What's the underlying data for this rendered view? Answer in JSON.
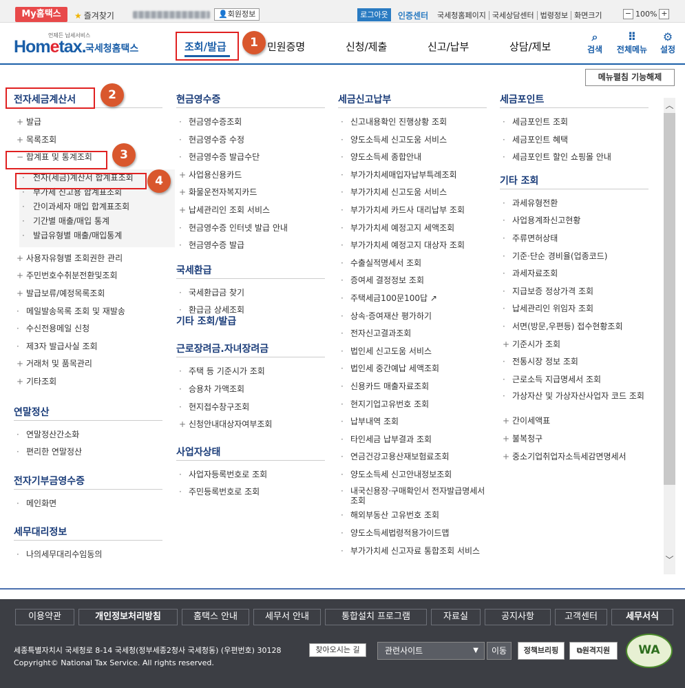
{
  "topbar": {
    "my_hometax": "My홈택스",
    "favorites": "즐겨찾기",
    "member_info": "회원정보",
    "logout": "로그아웃",
    "cert_center": "인증센터",
    "links": [
      "국세청홈페이지",
      "국세상담센터",
      "법령정보",
      "화면크기"
    ],
    "zoom_minus": "−",
    "zoom_value": "100%",
    "zoom_plus": "+"
  },
  "header": {
    "logo_sub": "언제든 납세서비스",
    "logo_main_a": "Hom",
    "logo_main_e": "e",
    "logo_main_b": "tax.",
    "logo_kr": "국세청홈택스",
    "gnb": [
      "조회/발급",
      "민원증명",
      "신청/제출",
      "신고/납부",
      "상담/제보"
    ],
    "tools": [
      {
        "icon": "search-icon",
        "glyph": "🔍",
        "label": "검색"
      },
      {
        "icon": "grid-icon",
        "glyph": "⠿",
        "label": "전체메뉴"
      },
      {
        "icon": "gear-icon",
        "glyph": "⚙",
        "label": "설정"
      }
    ]
  },
  "markers": [
    "1",
    "2",
    "3",
    "4"
  ],
  "menu_toggle": "메뉴펼침 기능해제",
  "col1": {
    "title": "전자세금계산서",
    "items_top": [
      {
        "icon": "plus",
        "label": "발급"
      },
      {
        "icon": "plus",
        "label": "목록조회"
      },
      {
        "icon": "minus",
        "label": "합계표 및 통계조회"
      }
    ],
    "sub_items": [
      "전자(세금)계산서 합계표조회",
      "부가세 신고용 합계표조회",
      "간이과세자 매입 합계표조회",
      "기간별 매출/매입 통계",
      "발급유형별 매출/매입통계"
    ],
    "items_bottom": [
      {
        "icon": "plus",
        "label": "사용자유형별 조회권한 관리"
      },
      {
        "icon": "plus",
        "label": "주민번호수취분전환및조회"
      },
      {
        "icon": "plus",
        "label": "발급보류/예정목록조회"
      },
      {
        "icon": "dot",
        "label": "메일발송목록 조회 및 재발송"
      },
      {
        "icon": "dot",
        "label": "수신전용메일 신청"
      },
      {
        "icon": "dot",
        "label": "제3자 발급사실 조회"
      },
      {
        "icon": "plus",
        "label": "거래처 및 품목관리"
      },
      {
        "icon": "plus",
        "label": "기타조회"
      }
    ],
    "title2": "연말정산",
    "items2": [
      "연말정산간소화",
      "편리한 연말정산"
    ],
    "title3": "전자기부금영수증",
    "items3": [
      "메인화면"
    ],
    "title4": "세무대리정보",
    "items4": [
      "나의세무대리수임동의"
    ]
  },
  "col2": {
    "title": "현금영수증",
    "items": [
      {
        "icon": "dot",
        "label": "현금영수증조회"
      },
      {
        "icon": "dot",
        "label": "현금영수증 수정"
      },
      {
        "icon": "dot",
        "label": "현금영수증 발급수단"
      },
      {
        "icon": "plus",
        "label": "사업용신용카드"
      },
      {
        "icon": "plus",
        "label": "화물운전자복지카드"
      },
      {
        "icon": "plus",
        "label": "납세관리인 조회 서비스"
      },
      {
        "icon": "dot",
        "label": "현금영수증 인터넷 발급 안내"
      },
      {
        "icon": "dot",
        "label": "현금영수증 발급"
      }
    ],
    "title2": "국세환급",
    "items2": [
      "국세환급금 찾기",
      "환급금 상세조회"
    ],
    "title2b": "기타 조회/발급",
    "title3": "근로장려금.자녀장려금",
    "items3": [
      "주택 등 기준시가 조회",
      "승용차 가액조회",
      "현지접수창구조회",
      "신청안내대상자여부조회"
    ],
    "title4": "사업자상태",
    "items4": [
      "사업자등록번호로 조회",
      "주민등록번호로 조회"
    ]
  },
  "col3": {
    "title": "세금신고납부",
    "items": [
      "신고내용확인 진행상황 조회",
      "양도소득세 신고도움 서비스",
      "양도소득세 종합안내",
      "부가가치세매입자납부특례조회",
      "부가가치세 신고도움 서비스",
      "부가가치세 카드사 대리납부 조회",
      "부가가치세 예정고지 세액조회",
      "부가가치세 예정고지 대상자 조회",
      "수출실적명세서 조회",
      "증여세 결정정보 조회",
      "주택세금100문100답",
      "상속·증여재산 평가하기",
      "전자신고결과조회",
      "법인세 신고도움 서비스",
      "법인세 중간예납 세액조회",
      "신용카드 매출자료조회",
      "현지기업고유번호 조회",
      "납부내역 조회",
      "타인세금 납부결과 조회",
      "연금건강고용산재보험료조회",
      "양도소득세 신고안내정보조회",
      "내국신용장·구매확인서 전자발급명세서 조회",
      "해외부동산 고유번호 조회",
      "양도소득세법령적용가이드맵",
      "부가가치세 신고자료 통합조회 서비스"
    ]
  },
  "col4": {
    "title": "세금포인트",
    "items": [
      "세금포인트 조회",
      "세금포인트 혜택",
      "세금포인트 할인 쇼핑몰 안내"
    ],
    "title2": "기타 조회",
    "items2": [
      {
        "icon": "dot",
        "label": "과세유형전환"
      },
      {
        "icon": "dot",
        "label": "사업용계좌신고현황"
      },
      {
        "icon": "dot",
        "label": "주류면허상태"
      },
      {
        "icon": "dot",
        "label": "기준·단순 경비율(업종코드)"
      },
      {
        "icon": "dot",
        "label": "과세자료조회"
      },
      {
        "icon": "dot",
        "label": "지급보증 정상가격 조회"
      },
      {
        "icon": "dot",
        "label": "납세관리인 위임자 조회"
      },
      {
        "icon": "dot",
        "label": "서면(방문,우편등) 접수현황조회"
      },
      {
        "icon": "plus",
        "label": "기준시가 조회"
      },
      {
        "icon": "dot",
        "label": "전통시장 정보 조회"
      },
      {
        "icon": "dot",
        "label": "근로소득 지급명세서 조회"
      },
      {
        "icon": "dot",
        "label": "가상자산 및 가상자산사업자 코드 조회"
      },
      {
        "icon": "plus",
        "label": "간이세액표"
      },
      {
        "icon": "plus",
        "label": "불복청구"
      },
      {
        "icon": "plus",
        "label": "중소기업취업자소득세감면명세서"
      }
    ]
  },
  "footer": {
    "nav": [
      "이용약관",
      "개인정보처리방침",
      "홈택스 안내",
      "세무서 안내",
      "통합설치 프로그램",
      "자료실",
      "공지사항",
      "고객센터",
      "세무서식"
    ],
    "address": "세종특별자치시 국세청로 8-14 국세청(정부세종2청사 국세청동) (우편번호) 30128",
    "find": "찾아오시는 길",
    "copyright": "Copyright© National Tax Service. All rights reserved.",
    "related": "관련사이트",
    "go": "이동",
    "policy_briefing": "정책브리핑",
    "remote_support": "원격지원",
    "wa_mark": "WA"
  }
}
